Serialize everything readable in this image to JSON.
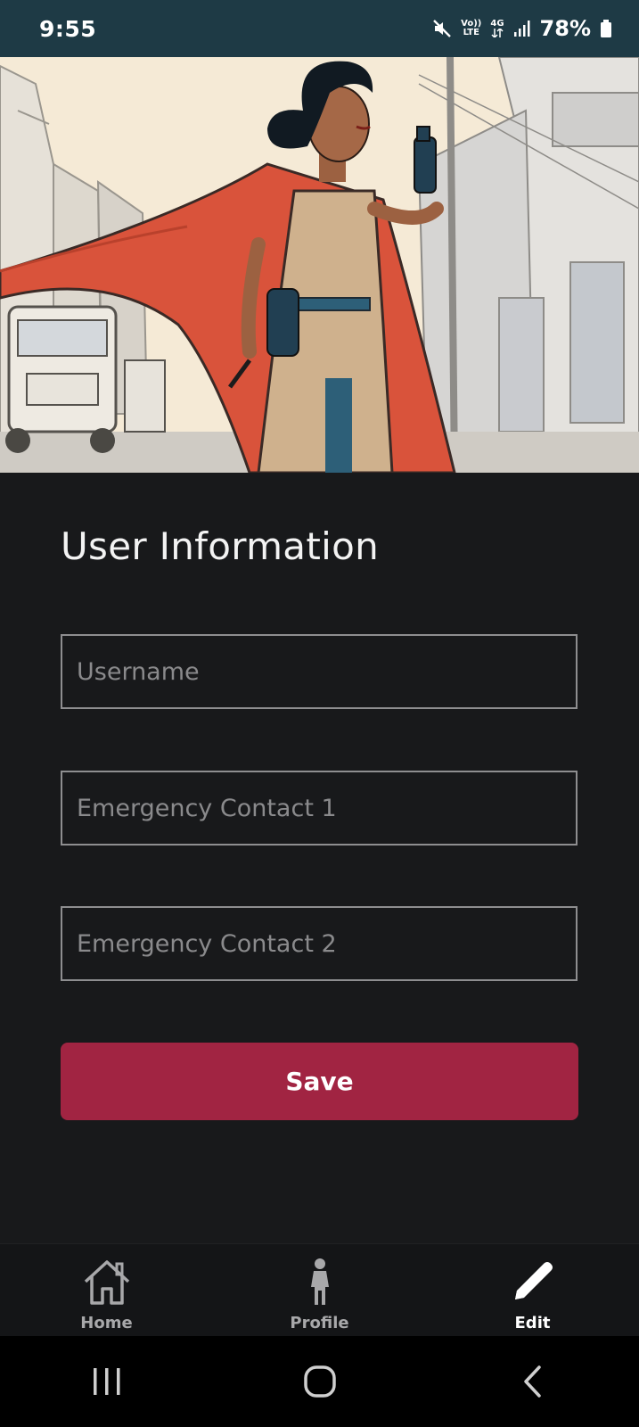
{
  "status_bar": {
    "time": "9:55",
    "network_top": "Vo))",
    "network_bottom": "LTE",
    "network_gen": "4G",
    "battery": "78%",
    "icons": [
      "mute-icon",
      "volte-icon",
      "4g-icon",
      "signal-icon",
      "battery-icon"
    ]
  },
  "hero": {
    "image": "illustration-woman-red-cape-street"
  },
  "form": {
    "title": "User Information",
    "fields": [
      {
        "placeholder": "Username",
        "value": ""
      },
      {
        "placeholder": "Emergency Contact 1",
        "value": ""
      },
      {
        "placeholder": "Emergency Contact 2",
        "value": ""
      }
    ],
    "save_label": "Save",
    "save_color": "#a12442"
  },
  "bottom_nav": {
    "items": [
      {
        "label": "Home",
        "icon": "home-icon",
        "active": false
      },
      {
        "label": "Profile",
        "icon": "person-icon",
        "active": false
      },
      {
        "label": "Edit",
        "icon": "pencil-icon",
        "active": true
      }
    ]
  },
  "system_nav": {
    "icons": [
      "recent-apps-icon",
      "home-circle-icon",
      "back-icon"
    ]
  }
}
